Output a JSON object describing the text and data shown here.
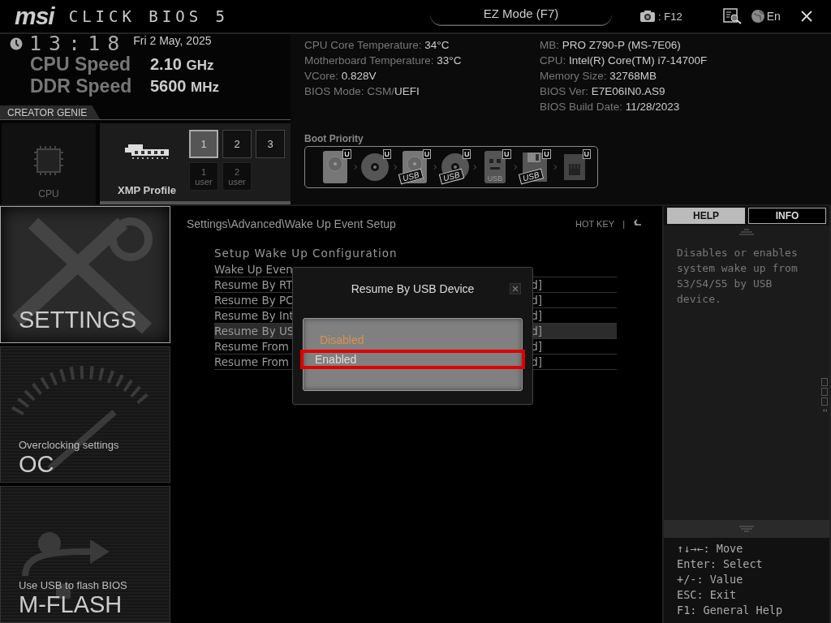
{
  "header": {
    "brand": "msi",
    "product": "CLICK BIOS 5",
    "ez_mode": "EZ Mode (F7)",
    "screenshot_key": ": F12",
    "language": "En"
  },
  "status": {
    "time": "13:18",
    "date": "Fri  2 May, 2025",
    "speeds": [
      {
        "label": "CPU Speed",
        "value": "2.10",
        "unit": "GHz"
      },
      {
        "label": "DDR Speed",
        "value": "5600",
        "unit": "MHz"
      }
    ]
  },
  "creator_genie": {
    "title": "CREATOR GENIE",
    "cpu_tile": {
      "label": "CPU",
      "selected": false
    },
    "xmp_tile": {
      "label": "XMP Profile",
      "selected": true,
      "profiles": [
        {
          "label": "1",
          "selected": true
        },
        {
          "label": "2",
          "selected": false
        },
        {
          "label": "3",
          "selected": false
        }
      ],
      "user_profiles": [
        {
          "number": "1",
          "caption": "user"
        },
        {
          "number": "2",
          "caption": "user"
        }
      ]
    }
  },
  "system_info": {
    "columns": [
      [
        {
          "label": "CPU Core Temperature: ",
          "value": "34°C"
        },
        {
          "label": "Motherboard Temperature: ",
          "value": "33°C"
        },
        {
          "label": "VCore: ",
          "value": "0.828V"
        },
        {
          "label": "BIOS Mode: CSM/",
          "value": "UEFI"
        }
      ],
      [
        {
          "label": "MB: ",
          "value": "PRO Z790-P (MS-7E06)"
        },
        {
          "label": "CPU: ",
          "value": "Intel(R) Core(TM) i7-14700F"
        },
        {
          "label": "Memory Size: ",
          "value": "32768MB"
        },
        {
          "label": "BIOS Ver: ",
          "value": "E7E06IN0.AS9"
        },
        {
          "label": "BIOS Build Date: ",
          "value": "11/28/2023"
        }
      ]
    ]
  },
  "boot_priority": {
    "title": "Boot Priority",
    "devices": [
      {
        "kind": "hdd",
        "badge": "U"
      },
      {
        "kind": "disc",
        "badge": "U"
      },
      {
        "kind": "hdd",
        "badge": "U",
        "tag": "USB"
      },
      {
        "kind": "disc",
        "badge": "U",
        "tag": "USB"
      },
      {
        "kind": "usb-key",
        "badge": "U",
        "label": "USB"
      },
      {
        "kind": "floppy",
        "badge": "U",
        "tag": "USB"
      },
      {
        "kind": "network",
        "badge": "U"
      }
    ]
  },
  "menu": [
    {
      "kind": "settings",
      "title": "SETTINGS",
      "selected": true
    },
    {
      "kind": "oc",
      "subtitle": "Overclocking settings",
      "title": "OC",
      "selected": false
    },
    {
      "kind": "mflash",
      "subtitle": "Use USB to flash BIOS",
      "title": "M-FLASH",
      "selected": false
    }
  ],
  "breadcrumb": "Settings\\Advanced\\Wake Up Event Setup",
  "hot_key": "HOT KEY",
  "hot_key_separator": "|",
  "settings": {
    "heading": "Setup Wake Up Configuration",
    "rows": [
      {
        "label": "Wake Up Even",
        "selected": false
      },
      {
        "label": "Resume By RT",
        "value": "d]",
        "selected": false
      },
      {
        "label": "Resume By PC",
        "value": "d]",
        "selected": false
      },
      {
        "label": "Resume By Int",
        "value": "d]",
        "selected": false
      },
      {
        "label": "Resume By US",
        "value": "d]",
        "selected": true
      },
      {
        "label": "Resume From",
        "value": "d]",
        "selected": false
      },
      {
        "label": "Resume From",
        "value": "d]",
        "selected": false
      }
    ]
  },
  "popup": {
    "title": "Resume By USB Device",
    "options": [
      {
        "label": "Disabled",
        "current": true,
        "selected": false
      },
      {
        "label": "Enabled",
        "current": false,
        "selected": true
      }
    ]
  },
  "help": {
    "tabs": [
      {
        "label": "HELP",
        "selected": true
      },
      {
        "label": "INFO",
        "selected": false
      }
    ],
    "text": "Disables or enables system wake up from S3/S4/S5 by USB device.",
    "keys": [
      "↑↓→←: Move",
      "Enter: Select",
      "+/-: Value",
      "ESC: Exit",
      "F1: General Help"
    ]
  }
}
